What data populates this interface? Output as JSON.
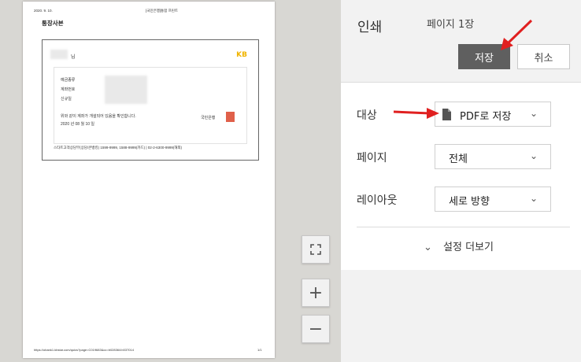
{
  "preview": {
    "header_date": "2020. 9. 10.",
    "header_title": "[국민은행]통합 프린트",
    "doc_title": "통장사본",
    "name_suffix": "님",
    "bank_logo": "KB",
    "fields": [
      "예금종류",
      "계좌번호",
      "신규일"
    ],
    "confirm_text": "위와 같이 계좌가 개설되어 있음을 확인합니다.",
    "issue_date": "2020 년 08 월 10 일",
    "bank_name": "국민은행",
    "footer_contact": "스타트고객상담부(상담/콘뱅킹) 1599-9999, 1588-9999(카드) | 02-2-6300-9999(해외)",
    "footer_url": "https://obank1.kbstar.com/quics?page=C019683&cc=b028364:b037014",
    "footer_page": "1/1"
  },
  "zoom": {
    "fit_icon": "fit-to-page-icon",
    "zoom_in": "+",
    "zoom_out": "−"
  },
  "sidebar": {
    "title": "인쇄",
    "page_count": "페이지 1장",
    "save_label": "저장",
    "cancel_label": "취소",
    "destination": {
      "label": "대상",
      "value": "PDF로 저장",
      "icon": "document-icon"
    },
    "pages": {
      "label": "페이지",
      "value": "전체"
    },
    "layout": {
      "label": "레이아웃",
      "value": "세로 방향"
    },
    "more_settings": "설정 더보기"
  },
  "colors": {
    "save_button": "#5f5f5f",
    "annotation_arrow": "#e02020",
    "kb_logo": "#f0b400"
  }
}
